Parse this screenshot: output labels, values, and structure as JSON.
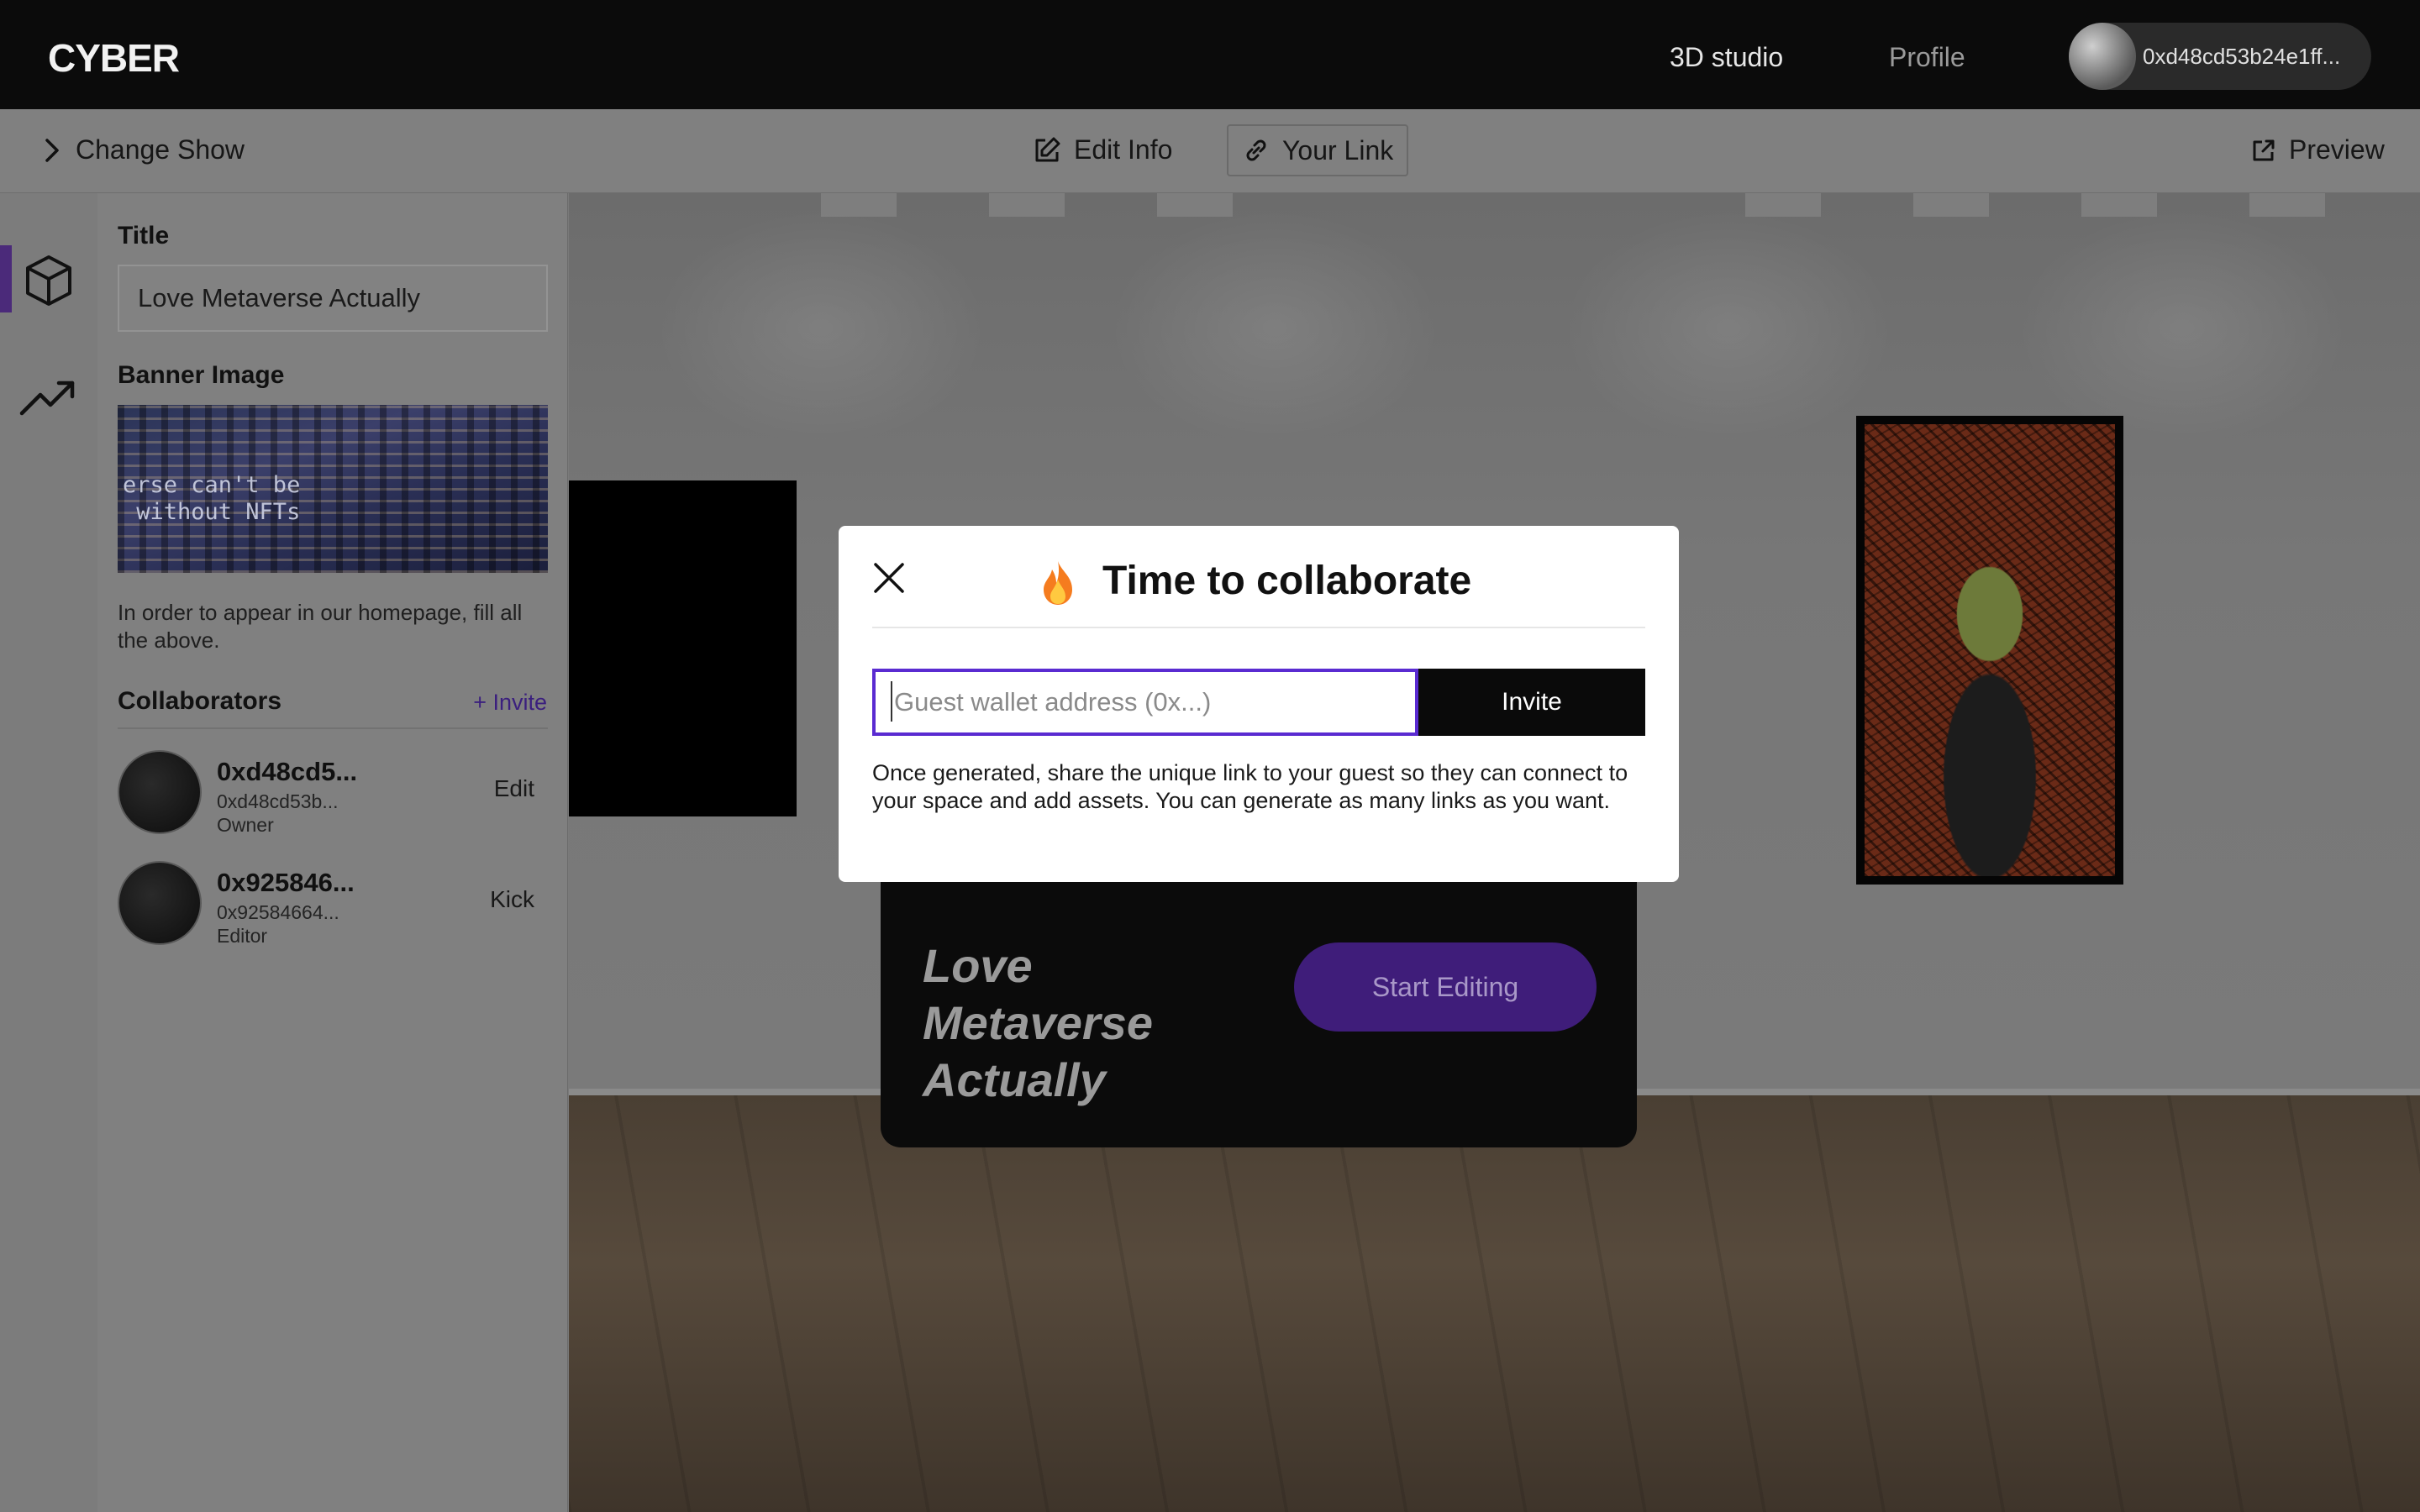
{
  "header": {
    "logo": "CYBER",
    "nav": {
      "studio": "3D studio",
      "profile": "Profile"
    },
    "wallet_address": "0xd48cd53b24e1ff..."
  },
  "toolbar": {
    "change_show": "Change Show",
    "edit_info": "Edit Info",
    "your_link": "Your Link",
    "preview": "Preview"
  },
  "sidebar": {
    "title_label": "Title",
    "title_value": "Love Metaverse Actually",
    "banner_label": "Banner Image",
    "banner_text": "erse can't be\n without NFTs",
    "hint": "In order to appear in our homepage, fill all the above.",
    "collaborators_label": "Collaborators",
    "invite_link": "+ Invite",
    "collaborators": [
      {
        "name": "0xd48cd5...",
        "address": "0xd48cd53b...",
        "role": "Owner",
        "action": "Edit"
      },
      {
        "name": "0x925846...",
        "address": "0x92584664...",
        "role": "Editor",
        "action": "Kick"
      }
    ]
  },
  "scene": {
    "show_title": "Love Metaverse Actually",
    "start_editing": "Start Editing"
  },
  "modal": {
    "emoji": "🔥",
    "title": "Time to collaborate",
    "input_placeholder": "Guest wallet address (0x...)",
    "invite_button": "Invite",
    "note": "Once generated, share the unique link to your guest so they can connect to your space and add assets. You can generate as many links as you want."
  },
  "colors": {
    "accent": "#5a2bd1",
    "accent_dark": "#3f1d7a",
    "header_bg": "#0b0b0b"
  }
}
